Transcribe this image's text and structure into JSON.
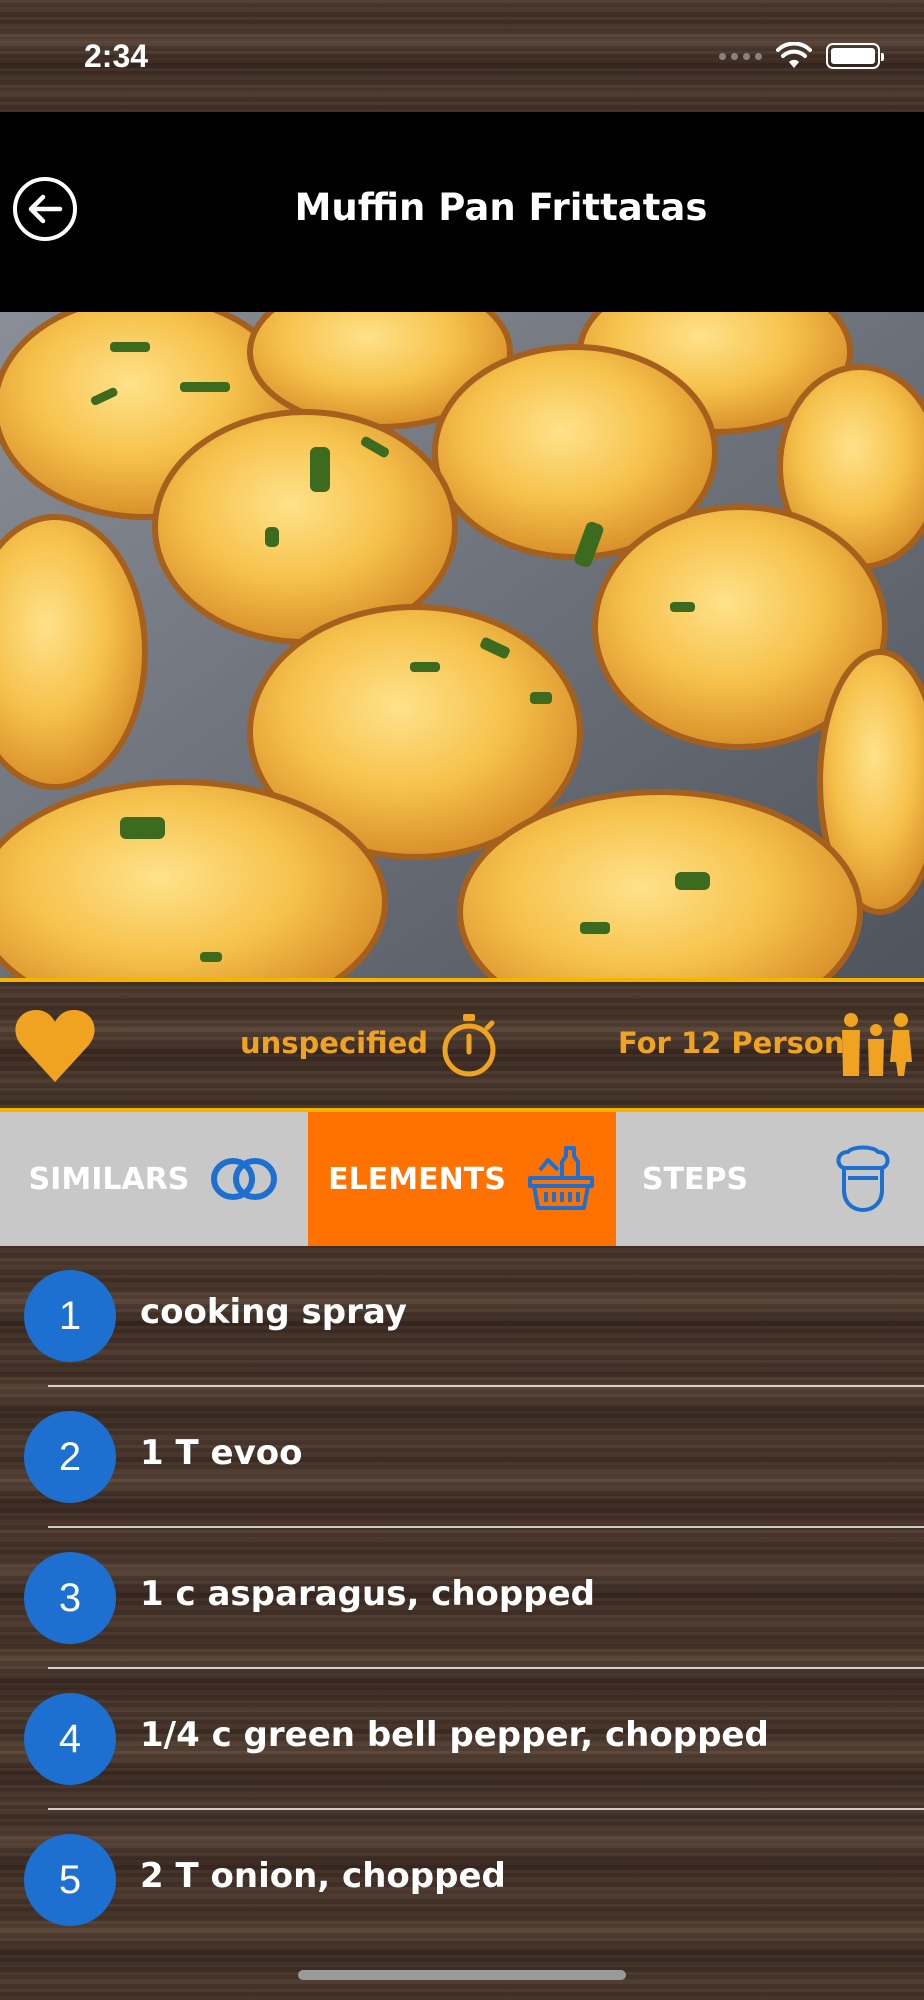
{
  "status_bar": {
    "time": "2:34"
  },
  "header": {
    "title": "Muffin Pan Frittatas",
    "back_icon": "back-arrow-circle-icon"
  },
  "hero": {
    "alt": "muffin pan frittatas"
  },
  "info": {
    "favorite_icon": "heart-icon",
    "time": "unspecified",
    "time_icon": "stopwatch-icon",
    "servings": "For 12 Person",
    "servings_icon": "people-icon"
  },
  "tabs": [
    {
      "label": "SIMILARS",
      "icon": "rings-icon",
      "active": false
    },
    {
      "label": "ELEMENTS",
      "icon": "basket-icon",
      "active": true
    },
    {
      "label": "STEPS",
      "icon": "chef-icon",
      "active": false
    }
  ],
  "ingredients": [
    {
      "num": "1",
      "text": "cooking spray"
    },
    {
      "num": "2",
      "text": "1 T evoo"
    },
    {
      "num": "3",
      "text": "1 c asparagus, chopped"
    },
    {
      "num": "4",
      "text": "1/4 c green bell pepper, chopped"
    },
    {
      "num": "5",
      "text": "2 T onion, chopped"
    }
  ],
  "colors": {
    "accent_orange": "#ff7200",
    "gold": "#f0a320",
    "badge_blue": "#1d70d0",
    "tab_gray": "#c8c8c8"
  }
}
